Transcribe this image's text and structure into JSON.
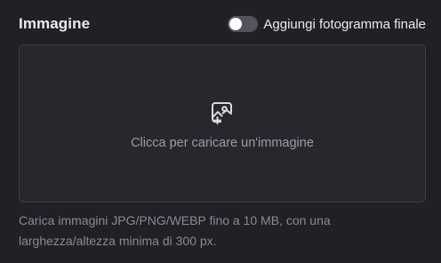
{
  "section": {
    "title": "Immagine"
  },
  "toggle": {
    "label": "Aggiungi fotogramma finale",
    "checked": false
  },
  "dropzone": {
    "icon": "image-upload-icon",
    "prompt": "Clicca per caricare un'immagine"
  },
  "hint": {
    "text": "Carica immagini JPG/PNG/WEBP fino a 10 MB, con una larghezza/altezza minima di 300 px."
  },
  "colors": {
    "background": "#221f26",
    "dropzone_background": "#29262e",
    "dropzone_border": "#3f3b46",
    "toggle_track": "#55525c"
  }
}
